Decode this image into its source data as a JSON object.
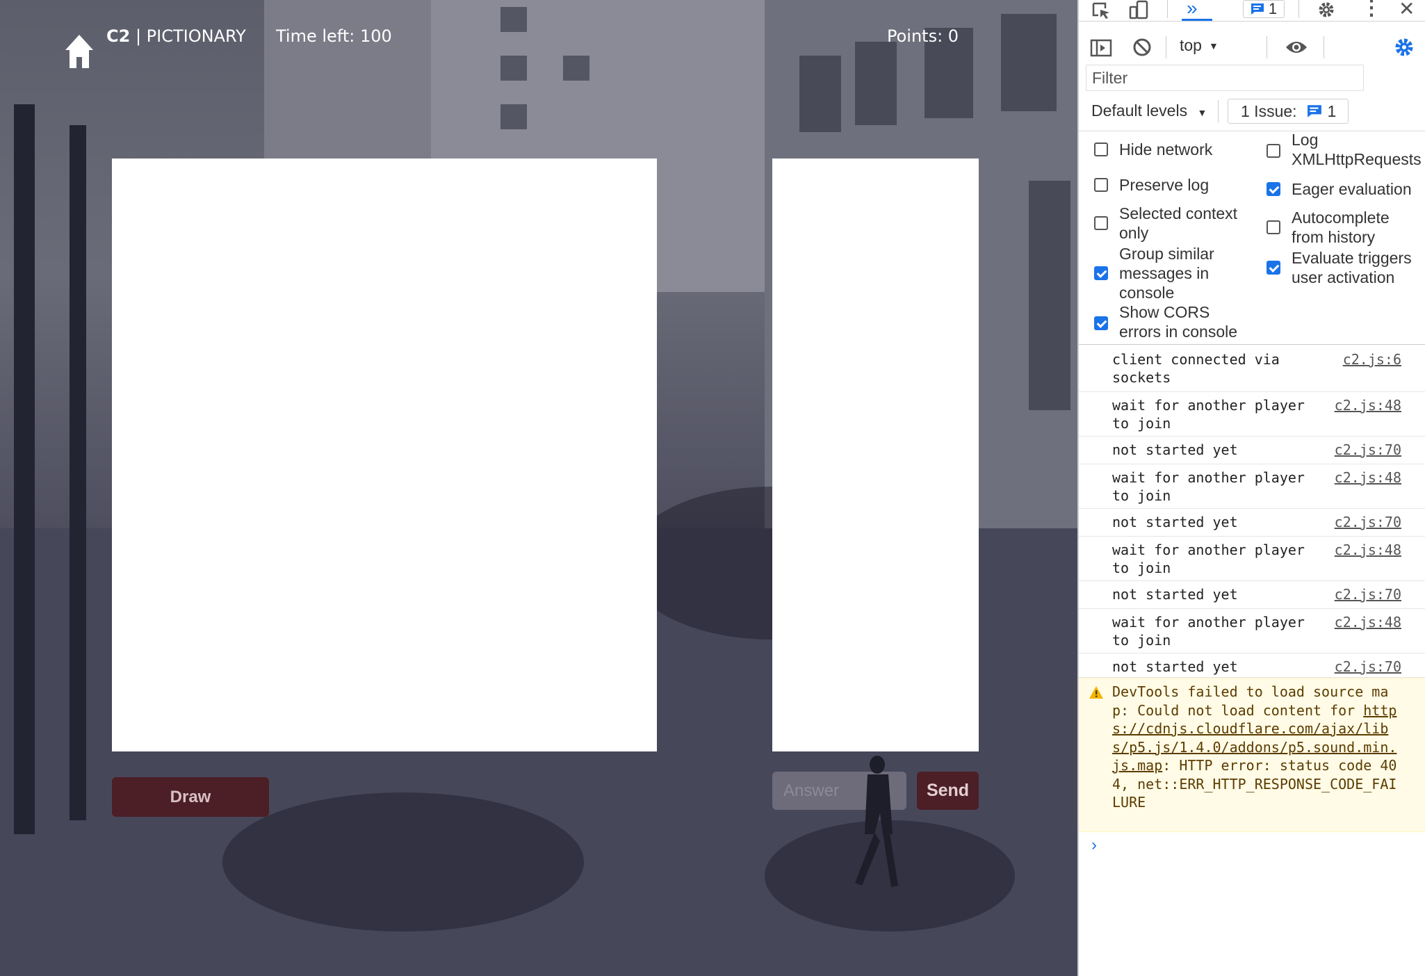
{
  "game": {
    "brand": "C2",
    "title": "| PICTIONARY",
    "time_label": "Time left: 100",
    "points_label": "Points: 0",
    "draw_label": "Draw",
    "answer_placeholder": "Answer",
    "send_label": "Send"
  },
  "devtools": {
    "issues_badge_count": "1",
    "context": "top",
    "filter_placeholder": "Filter",
    "levels_label": "Default levels",
    "issues_label": "1 Issue:",
    "issues_count": "1",
    "settings": [
      {
        "label": "Hide network",
        "checked": false
      },
      {
        "label": "Log XMLHttpRequests",
        "checked": false
      },
      {
        "label": "Preserve log",
        "checked": false
      },
      {
        "label": "Eager evaluation",
        "checked": true
      },
      {
        "label": "Selected context only",
        "checked": false
      },
      {
        "label": "Autocomplete from history",
        "checked": false
      },
      {
        "label": "Group similar messages in console",
        "checked": true
      },
      {
        "label": "Evaluate triggers user activation",
        "checked": true
      },
      {
        "label": "Show CORS errors in console",
        "checked": true
      }
    ],
    "logs": [
      {
        "message": "client connected via sockets",
        "source": "c2.js:6"
      },
      {
        "message": "wait for another player to join",
        "source": "c2.js:48"
      },
      {
        "message": "not started yet",
        "source": "c2.js:70"
      },
      {
        "message": "wait for another player to join",
        "source": "c2.js:48"
      },
      {
        "message": "not started yet",
        "source": "c2.js:70"
      },
      {
        "message": "wait for another player to join",
        "source": "c2.js:48"
      },
      {
        "message": "not started yet",
        "source": "c2.js:70"
      },
      {
        "message": "wait for another player to join",
        "source": "c2.js:48"
      },
      {
        "message": "not started yet",
        "source": "c2.js:70"
      }
    ],
    "warning": {
      "prefix": "DevTools failed to load source map: Could not load content for ",
      "url": "https://cdnjs.cloudflare.com/ajax/libs/p5.js/1.4.0/addons/p5.sound.min.js.map",
      "suffix": ": HTTP error: status code 404, net::ERR_HTTP_RESPONSE_CODE_FAILURE"
    },
    "prompt": "›"
  }
}
